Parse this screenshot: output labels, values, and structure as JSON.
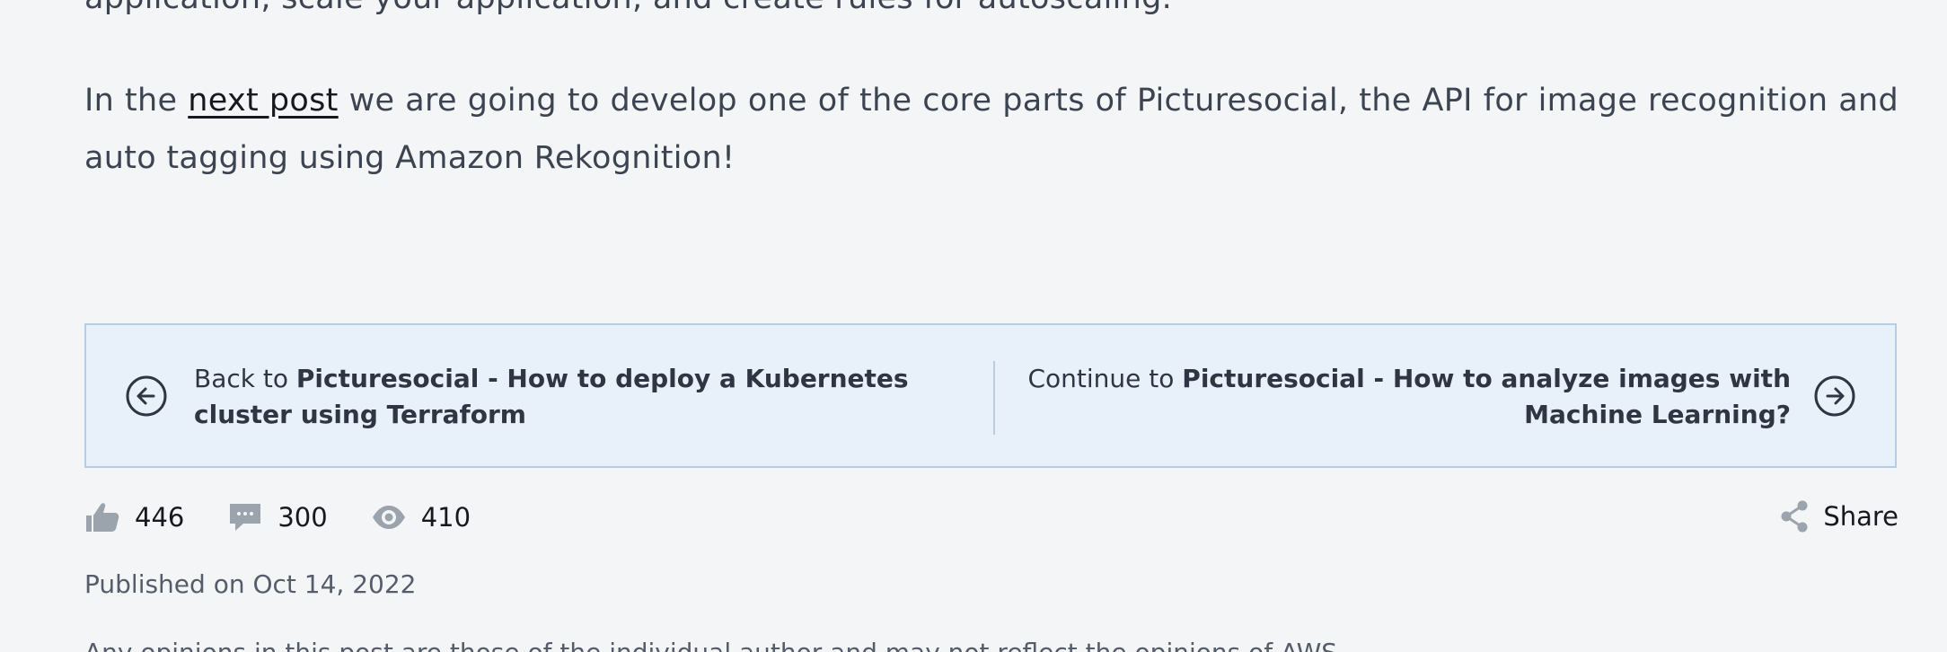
{
  "article": {
    "prev_paragraph_tail": "application, scale your application, and create rules for autoscaling.",
    "paragraph_before_link": "In the ",
    "paragraph_link": "next post",
    "paragraph_after_link": " we are going to develop one of the core parts of Picturesocial, the API for image recognition and auto tagging using Amazon Rekognition!"
  },
  "nav": {
    "back_prefix": "Back to ",
    "back_title": "Picturesocial - How to deploy a Kubernetes cluster using Terraform",
    "continue_prefix": "Continue to ",
    "continue_title": "Picturesocial - How to analyze images with Machine Learning?"
  },
  "stats": {
    "likes": "446",
    "comments": "300",
    "views": "410",
    "share_label": "Share"
  },
  "meta": {
    "published": "Published on Oct 14, 2022",
    "disclaimer": "Any opinions in this post are those of the individual author and may not reflect the opinions of AWS."
  },
  "colors": {
    "background": "#f4f5f7",
    "nav_background": "#e8f0fa",
    "nav_border": "#b7cde3",
    "icon_gray": "#9ba3ad",
    "text": "#3d4451"
  },
  "icons": {
    "back": "arrow-left-circle-icon",
    "continue": "arrow-right-circle-icon",
    "likes": "thumbs-up-icon",
    "comments": "comment-icon",
    "views": "eye-icon",
    "share": "share-icon"
  }
}
